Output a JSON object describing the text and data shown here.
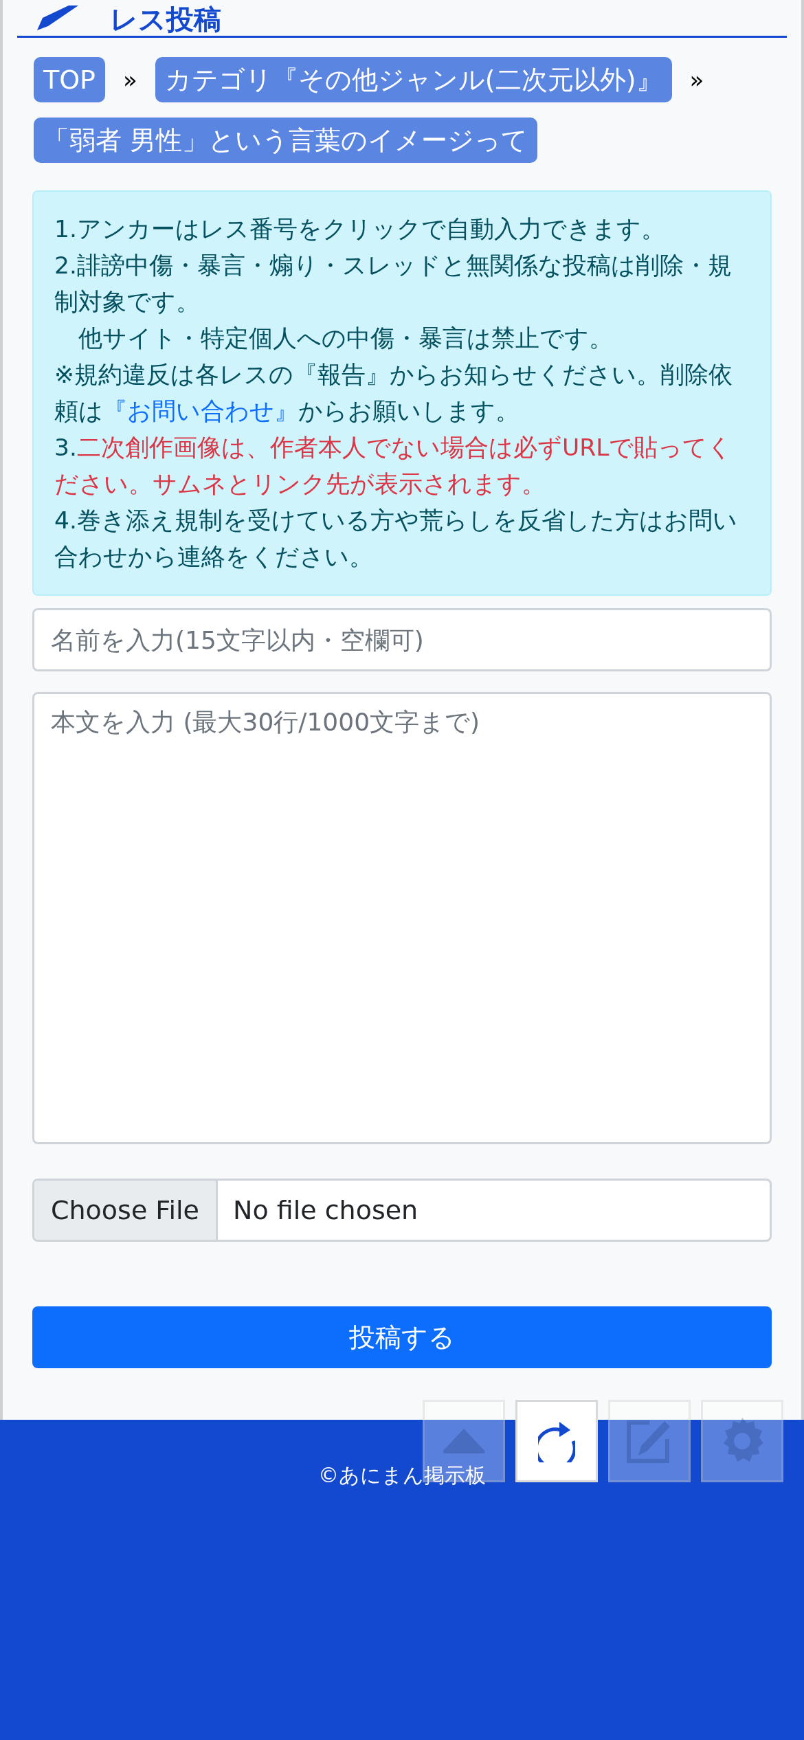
{
  "header": {
    "title": "レス投稿"
  },
  "breadcrumbs": [
    {
      "kind": "link",
      "text": "TOP"
    },
    {
      "kind": "separator",
      "text": "»"
    },
    {
      "kind": "link",
      "text": "カテゴリ『その他ジャンル(二次元以外)』"
    },
    {
      "kind": "separator",
      "text": "»"
    },
    {
      "kind": "link",
      "text": "「弱者 男性」という言葉のイメージって"
    }
  ],
  "notice": {
    "lines": [
      [
        {
          "kind": "text",
          "text": "1.アンカーはレス番号をクリックで自動入力できます。"
        }
      ],
      [
        {
          "kind": "text",
          "text": "2.誹謗中傷・暴言・煽り・スレッドと無関係な投稿は削除・規制対象です。"
        }
      ],
      [
        {
          "kind": "text",
          "text": "　他サイト・特定個人への中傷・暴言は禁止です。"
        }
      ],
      [
        {
          "kind": "text",
          "text": "※規約違反は各レスの『報告』からお知らせください。削除依頼は"
        },
        {
          "kind": "link",
          "text": "『お問い合わせ』"
        },
        {
          "kind": "text",
          "text": "からお願いします。"
        }
      ],
      [
        {
          "kind": "text",
          "text": "3."
        },
        {
          "kind": "warning",
          "text": "二次創作画像は、作者本人でない場合は必ずURLで貼ってください。サムネとリンク先が表示されます。"
        }
      ],
      [
        {
          "kind": "text",
          "text": "4.巻き添え規制を受けている方や荒らしを反省した方はお問い合わせから連絡をください。"
        }
      ]
    ]
  },
  "form": {
    "name_field": {
      "placeholder": "名前を入力(15文字以内・空欄可)"
    },
    "body_field": {
      "placeholder": "本文を入力 (最大30行/1000文字まで)"
    },
    "file_button": "Choose File",
    "file_status": "No file chosen",
    "submit": "投稿する"
  },
  "float_buttons": [
    {
      "kind": "up",
      "disabled": true
    },
    {
      "kind": "reload",
      "disabled": false
    },
    {
      "kind": "edit",
      "disabled": true
    },
    {
      "kind": "settings",
      "disabled": true
    }
  ],
  "footer": {
    "copyright": "©あにまん掲示板"
  }
}
